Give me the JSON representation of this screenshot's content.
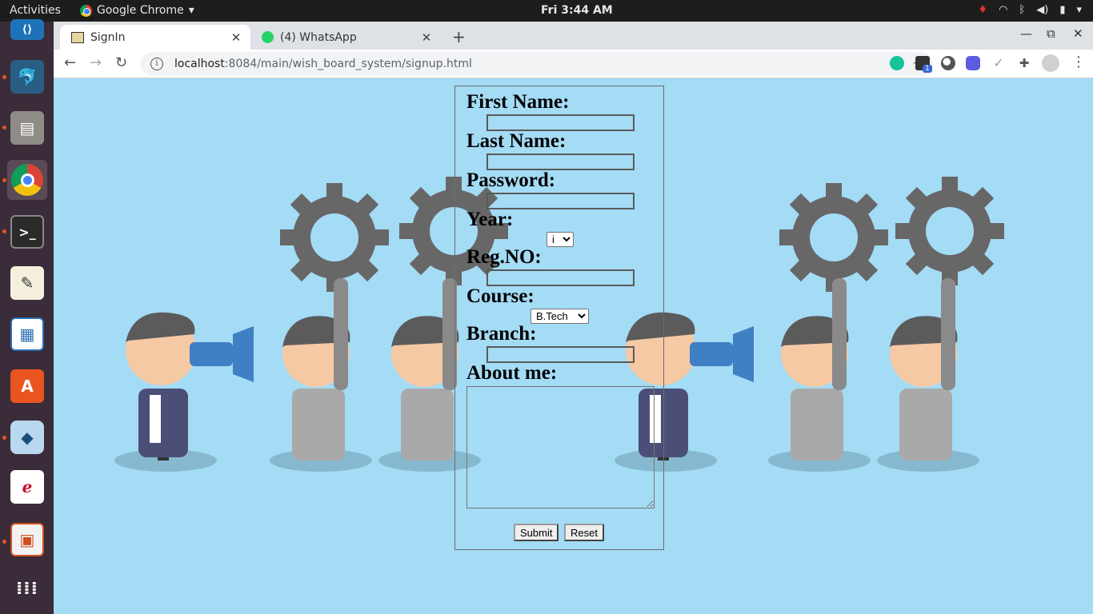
{
  "topbar": {
    "activities": "Activities",
    "app_menu": "Google Chrome",
    "clock": "Fri  3:44 AM"
  },
  "tabs": [
    {
      "label": "SignIn",
      "active": true
    },
    {
      "label": "(4) WhatsApp",
      "active": false
    }
  ],
  "address_bar": {
    "host": "localhost",
    "path": ":8084/main/wish_board_system/signup.html"
  },
  "extensions": {
    "badge": "1"
  },
  "form": {
    "first_name_label": "First Name:",
    "last_name_label": "Last Name:",
    "password_label": "Password:",
    "year_label": "Year:",
    "year_selected": "i",
    "regno_label": "Reg.NO:",
    "course_label": "Course:",
    "course_selected": "B.Tech",
    "branch_label": "Branch:",
    "about_label": "About me:",
    "submit_label": "Submit",
    "reset_label": "Reset"
  },
  "colors": {
    "page_bg": "#a4dbf5",
    "dock_bg": "#3a2c38",
    "topbar_bg": "#1d1d1d"
  }
}
